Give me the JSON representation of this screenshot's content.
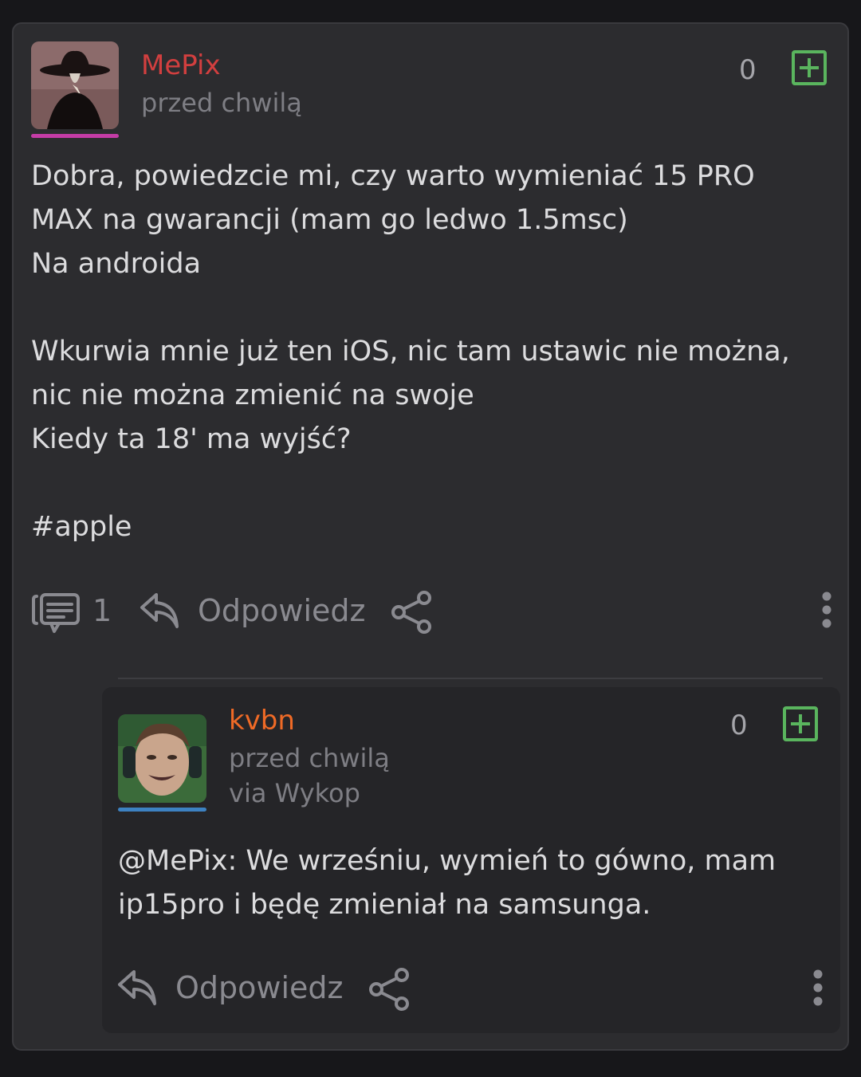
{
  "post": {
    "author": "MePix",
    "author_color": "#d23f3f",
    "avatar_accent": "#c43ca6",
    "time": "przed chwilą",
    "score": "0",
    "body_lines": [
      "Dobra, powiedzcie mi, czy warto wymieniać 15 PRO",
      "MAX na gwarancji (mam go ledwo 1.5msc)",
      "Na androida",
      "",
      "Wkurwia mnie już ten iOS, nic tam ustawic nie można,",
      "nic nie można zmienić na swoje",
      "Kiedy ta 18' ma wyjść?",
      "",
      "#apple"
    ],
    "comment_count": "1",
    "reply_label": "Odpowiedz"
  },
  "reply": {
    "author": "kvbn",
    "author_color": "#ef6a26",
    "avatar_accent": "#3d82c2",
    "time": "przed chwilą",
    "via": "via Wykop",
    "score": "0",
    "body_lines": [
      "@MePix: We wrześniu, wymień to gówno, mam",
      "ip15pro i będę zmieniał na samsunga."
    ],
    "reply_label": "Odpowiedz"
  },
  "icons": {
    "comments": "comments-icon",
    "reply": "reply-arrow-icon",
    "share": "share-icon",
    "more": "more-vertical-icon",
    "plus": "plus-square-icon"
  },
  "colors": {
    "background": "#17171a",
    "card": "#2c2c2f",
    "reply_card": "#252528",
    "plus": "#5ab55e"
  }
}
